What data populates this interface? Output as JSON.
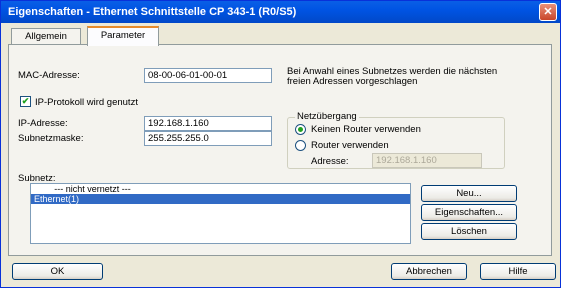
{
  "window": {
    "title": "Eigenschaften - Ethernet Schnittstelle  CP 343-1 (R0/S5)",
    "close_glyph": "✕"
  },
  "tabs": [
    {
      "label": "Allgemein",
      "active": false
    },
    {
      "label": "Parameter",
      "active": true
    }
  ],
  "mac": {
    "label": "MAC-Adresse:",
    "value": "08-00-06-01-00-01",
    "hint": "Bei Anwahl eines Subnetzes werden die nächsten freien Adressen vorgeschlagen"
  },
  "ip_protocol": {
    "label": "IP-Protokoll wird genutzt",
    "checked": true,
    "check_glyph": "✔"
  },
  "ip": {
    "ip_label": "IP-Adresse:",
    "ip_value": "192.168.1.160",
    "mask_label": "Subnetzmaske:",
    "mask_value": "255.255.255.0"
  },
  "gateway": {
    "title": "Netzübergang",
    "option_no_router": "Keinen Router verwenden",
    "option_router": "Router verwenden",
    "selected": "no_router",
    "address_label": "Adresse:",
    "address_value": "192.168.1.160"
  },
  "subnet": {
    "label": "Subnetz:",
    "items": [
      {
        "text": "--- nicht vernetzt ---",
        "selected": false
      },
      {
        "text": "Ethernet(1)",
        "selected": true
      }
    ],
    "buttons": {
      "new": "Neu...",
      "properties": "Eigenschaften...",
      "delete": "Löschen"
    }
  },
  "footer": {
    "ok": "OK",
    "cancel": "Abbrechen",
    "help": "Hilfe"
  }
}
